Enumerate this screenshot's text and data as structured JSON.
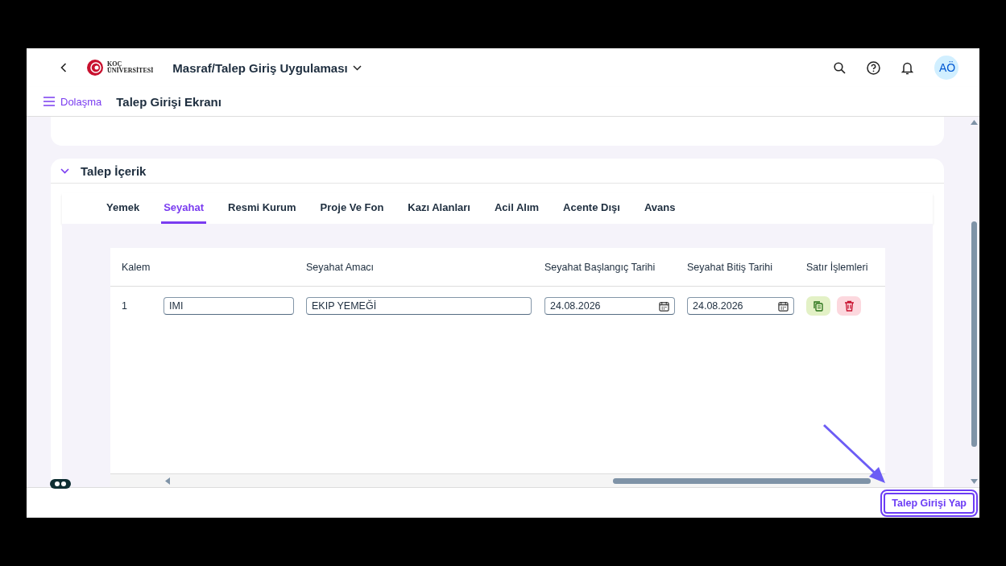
{
  "header": {
    "app_title": "Masraf/Talep Giriş Uygulaması",
    "logo_line_1": "KOÇ",
    "logo_line_2": "ÜNİVERSİTESİ",
    "avatar": "AÖ"
  },
  "subheader": {
    "nav": "Dolaşma",
    "page_title": "Talep Girişi Ekranı"
  },
  "section": {
    "title": "Talep İçerik",
    "expanded": true,
    "tabs": [
      {
        "label": "Yemek",
        "selected": false
      },
      {
        "label": "Seyahat",
        "selected": true
      },
      {
        "label": "Resmi Kurum",
        "selected": false
      },
      {
        "label": "Proje Ve Fon",
        "selected": false
      },
      {
        "label": "Kazı Alanları",
        "selected": false
      },
      {
        "label": "Acil Alım",
        "selected": false
      },
      {
        "label": "Acente Dışı",
        "selected": false
      },
      {
        "label": "Avans",
        "selected": false
      }
    ],
    "table": {
      "columns": [
        "Kalem",
        "",
        "Seyahat Amacı",
        "Seyahat Başlangıç Tarihi",
        "Seyahat Bitiş Tarihi",
        "Satır İşlemleri"
      ],
      "rows": [
        {
          "kalem": "1",
          "column_2": "IMI",
          "purpose": "EKIP YEMEĞİ",
          "start": "24.08.2026",
          "end": "24.08.2026"
        }
      ]
    }
  },
  "footer": {
    "button": "Talep Girişi Yap"
  }
}
